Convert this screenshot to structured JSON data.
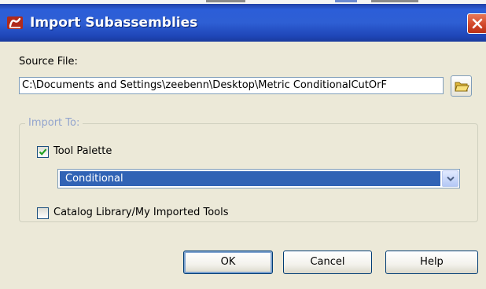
{
  "window": {
    "title": "Import Subassemblies"
  },
  "source": {
    "label": "Source File:",
    "path": "C:\\Documents and Settings\\zeebenn\\Desktop\\Metric ConditionalCutOrF"
  },
  "import_to": {
    "group_label": "Import To:",
    "tool_palette": {
      "label": "Tool Palette",
      "checked": true,
      "selected": "Conditional"
    },
    "catalog": {
      "label": "Catalog Library/My Imported Tools",
      "checked": false
    }
  },
  "buttons": {
    "ok": "OK",
    "cancel": "Cancel",
    "help": "Help"
  },
  "colors": {
    "titlebar": "#2e5fd4",
    "selection": "#3163b5",
    "close": "#d2482a",
    "dialog_bg": "#ece9d8"
  },
  "icons": {
    "app": "civil-app-icon",
    "close": "close-icon",
    "browse": "folder-open-icon",
    "check": "checkmark-icon",
    "dropdown": "chevron-down-icon"
  }
}
